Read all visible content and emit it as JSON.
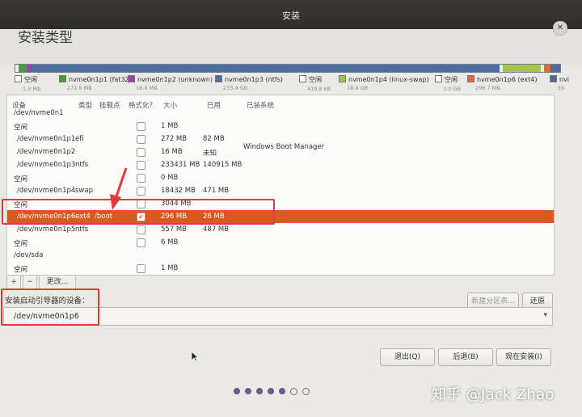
{
  "window": {
    "title": "安装",
    "heading": "安装类型",
    "close_icon": "close-icon"
  },
  "partition_bar": {
    "segments": [
      {
        "label": "空闲",
        "color": "#ffffff",
        "fraction": 0.006
      },
      {
        "label": "nvme0n1p1 (fat32)",
        "color": "#4a9a3b",
        "fraction": 0.015
      },
      {
        "label": "nvme0n1p2 (unknown)",
        "color": "#9f3fb8",
        "fraction": 0.008
      },
      {
        "label": "nvme0n1p3 (ntfs)",
        "color": "#4f6d9f",
        "fraction": 0.86
      },
      {
        "label": "空闲",
        "color": "#ffffff",
        "fraction": 0.006
      },
      {
        "label": "nvme0n1p4 (linux-swap)",
        "color": "#a7c34a",
        "fraction": 0.07
      },
      {
        "label": "空闲",
        "color": "#ffffff",
        "fraction": 0.006
      },
      {
        "label": "nvme0n1p6 (ext4)",
        "color": "#e36a26",
        "fraction": 0.012
      },
      {
        "label": "nvm",
        "color": "#4f6d9f",
        "fraction": 0.017
      }
    ]
  },
  "legend": [
    {
      "label": "空闲",
      "size": "1.0 MB",
      "color": "#ffffff"
    },
    {
      "label": "nvme0n1p1 (fat32)",
      "size": "272.6 MB",
      "color": "#4a9a3b"
    },
    {
      "label": "nvme0n1p2 (unknown)",
      "size": "16.8 MB",
      "color": "#9f3fb8"
    },
    {
      "label": "nvme0n1p3 (ntfs)",
      "size": "233.4 GB",
      "color": "#4f6d9f"
    },
    {
      "label": "空闲",
      "size": "419.8 kB",
      "color": "#ffffff"
    },
    {
      "label": "nvme0n1p4 (linux-swap)",
      "size": "18.4 GB",
      "color": "#a7c34a"
    },
    {
      "label": "空闲",
      "size": "3.0 GB",
      "color": "#ffffff"
    },
    {
      "label": "nvme0n1p6 (ext4)",
      "size": "296.7 MB",
      "color": "#e36a26"
    },
    {
      "label": "nvi",
      "size": "55",
      "color": "#4f6d9f"
    }
  ],
  "table": {
    "headers": {
      "device": "设备",
      "type": "类型",
      "mount": "挂载点",
      "format": "格式化？",
      "size": "大小",
      "used": "已用",
      "system": "已装系统"
    },
    "rows": [
      {
        "device": "/dev/nvme0n1",
        "type": "",
        "mount": "",
        "check": "",
        "size": "",
        "used": "",
        "system": ""
      },
      {
        "device": "空闲",
        "type": "",
        "mount": "",
        "check": "box",
        "size": "1 MB",
        "used": "",
        "system": ""
      },
      {
        "device": "/dev/nvme0n1p1",
        "type": "efi",
        "mount": "",
        "check": "box",
        "size": "272 MB",
        "used": "82 MB",
        "system": ""
      },
      {
        "device": "/dev/nvme0n1p2",
        "type": "",
        "mount": "",
        "check": "box",
        "size": "16 MB",
        "used": "未知",
        "system": ""
      },
      {
        "device": "/dev/nvme0n1p3",
        "type": "ntfs",
        "mount": "",
        "check": "box",
        "size": "233431 MB",
        "used": "140915 MB",
        "system": ""
      },
      {
        "device": "空闲",
        "type": "",
        "mount": "",
        "check": "box",
        "size": "0 MB",
        "used": "",
        "system": ""
      },
      {
        "device": "/dev/nvme0n1p4",
        "type": "swap",
        "mount": "",
        "check": "box",
        "size": "18432 MB",
        "used": "471 MB",
        "system": ""
      },
      {
        "device": "空闲",
        "type": "",
        "mount": "",
        "check": "box",
        "size": "3044 MB",
        "used": "",
        "system": ""
      },
      {
        "device": "/dev/nvme0n1p6",
        "type": "ext4",
        "mount": "/boot",
        "check": "checked",
        "size": "296 MB",
        "used": "26 MB",
        "system": "",
        "selected": true
      },
      {
        "device": "/dev/nvme0n1p5",
        "type": "ntfs",
        "mount": "",
        "check": "box",
        "size": "557 MB",
        "used": "487 MB",
        "system": ""
      },
      {
        "device": "空闲",
        "type": "",
        "mount": "",
        "check": "box",
        "size": "6 MB",
        "used": "",
        "system": ""
      },
      {
        "device": "/dev/sda",
        "type": "",
        "mount": "",
        "check": "",
        "size": "",
        "used": "",
        "system": ""
      },
      {
        "device": "空闲",
        "type": "",
        "mount": "",
        "check": "box",
        "size": "1 MB",
        "used": "",
        "system": ""
      }
    ],
    "windows_boot_manager": "Windows Boot Manager"
  },
  "toolbar": {
    "add": "+",
    "remove": "−",
    "change": "更改..."
  },
  "buttons": {
    "new_table": "新建分区表...",
    "revert": "还原",
    "quit": "退出(Q)",
    "back": "后退(B)",
    "install": "现在安装(I)"
  },
  "boot_loader": {
    "label": "安装启动引导器的设备：",
    "value": "/dev/nvme0n1p6"
  },
  "progress": {
    "total": 7,
    "current": 5
  },
  "watermark": "知乎 @Jack Zhao"
}
